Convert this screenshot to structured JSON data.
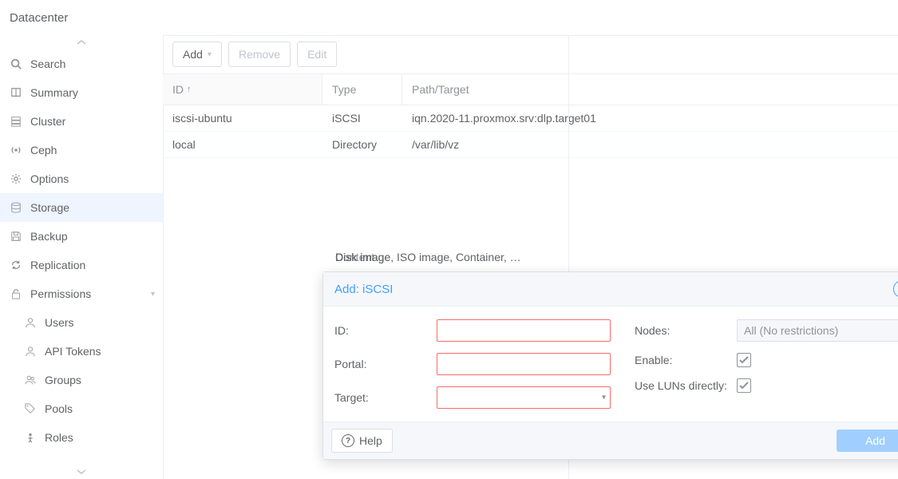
{
  "header": {
    "title": "Datacenter"
  },
  "sidebar": {
    "items": [
      {
        "icon": "search-icon",
        "label": "Search",
        "name": "sidebar-item-search"
      },
      {
        "icon": "book-icon",
        "label": "Summary",
        "name": "sidebar-item-summary"
      },
      {
        "icon": "server-icon",
        "label": "Cluster",
        "name": "sidebar-item-cluster"
      },
      {
        "icon": "broadcast-icon",
        "label": "Ceph",
        "name": "sidebar-item-ceph"
      },
      {
        "icon": "gear-icon",
        "label": "Options",
        "name": "sidebar-item-options"
      },
      {
        "icon": "database-icon",
        "label": "Storage",
        "name": "sidebar-item-storage",
        "selected": true
      },
      {
        "icon": "save-icon",
        "label": "Backup",
        "name": "sidebar-item-backup"
      },
      {
        "icon": "refresh-icon",
        "label": "Replication",
        "name": "sidebar-item-replication"
      },
      {
        "icon": "unlock-icon",
        "label": "Permissions",
        "name": "sidebar-item-permissions",
        "expandable": true
      },
      {
        "icon": "user-icon",
        "label": "Users",
        "name": "sidebar-item-users",
        "sub": true
      },
      {
        "icon": "key-icon",
        "label": "API Tokens",
        "name": "sidebar-item-api-tokens",
        "sub": true
      },
      {
        "icon": "users-icon",
        "label": "Groups",
        "name": "sidebar-item-groups",
        "sub": true
      },
      {
        "icon": "tags-icon",
        "label": "Pools",
        "name": "sidebar-item-pools",
        "sub": true
      },
      {
        "icon": "person-icon",
        "label": "Roles",
        "name": "sidebar-item-roles",
        "sub": true
      }
    ]
  },
  "toolbar": {
    "add_label": "Add",
    "remove_label": "Remove",
    "edit_label": "Edit"
  },
  "grid": {
    "columns": {
      "id": "ID",
      "type": "Type",
      "content": "Content",
      "path": "Path/Target"
    },
    "rows": [
      {
        "id": "iscsi-ubuntu",
        "type": "iSCSI",
        "content": "Disk image",
        "path": "iqn.2020-11.proxmox.srv:dlp.target01"
      },
      {
        "id": "local",
        "type": "Directory",
        "content": "Disk image, ISO image, Container, …",
        "path": "/var/lib/vz"
      }
    ]
  },
  "modal": {
    "title": "Add: iSCSI",
    "labels": {
      "id": "ID:",
      "portal": "Portal:",
      "target": "Target:",
      "nodes": "Nodes:",
      "enable": "Enable:",
      "use_luns": "Use LUNs directly:"
    },
    "values": {
      "id": "",
      "portal": "",
      "target": "",
      "nodes": "All (No restrictions)",
      "enable": true,
      "use_luns": true
    },
    "help_label": "Help",
    "add_label": "Add"
  }
}
